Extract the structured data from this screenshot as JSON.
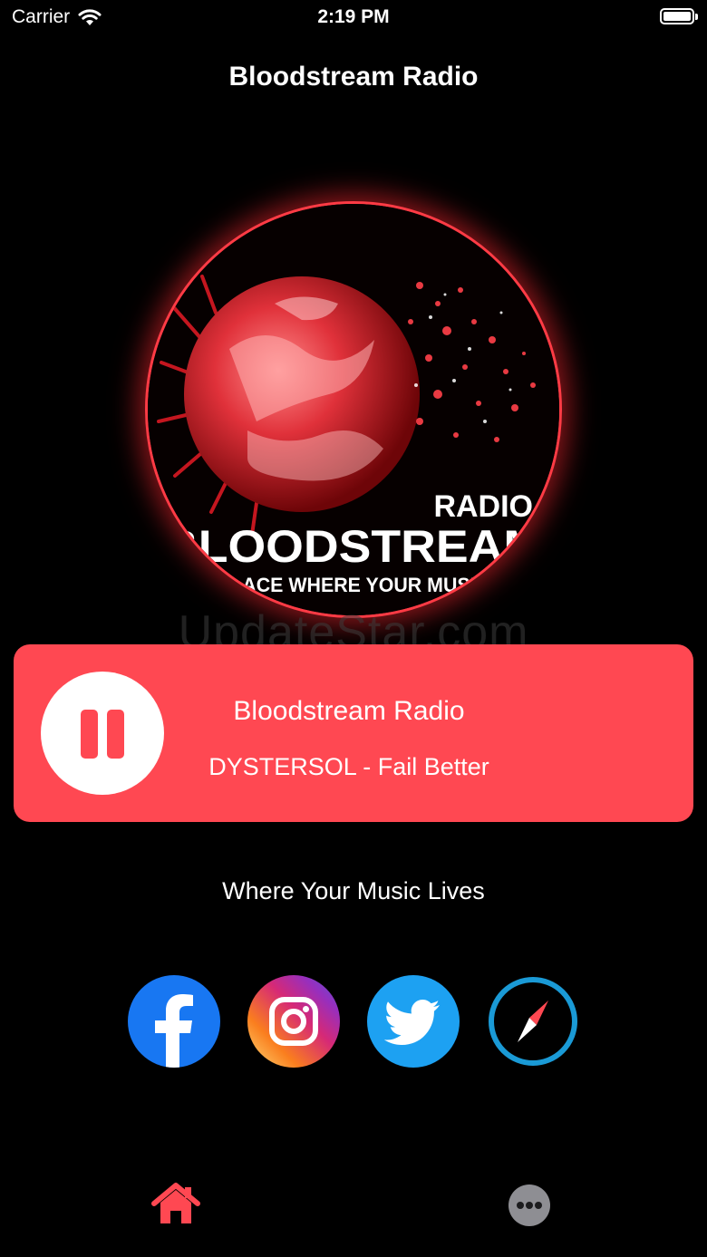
{
  "status_bar": {
    "carrier": "Carrier",
    "time": "2:19 PM",
    "battery_level": 1.0
  },
  "nav": {
    "title": "Bloodstream Radio"
  },
  "logo": {
    "small_text": "RADIO",
    "main_text": "BLOODSTREAM",
    "slogan_text": "PLACE WHERE YOUR MUSIC",
    "accent_color": "#ff3b45"
  },
  "watermark": "UpdateStar.com",
  "player": {
    "state": "playing",
    "control_icon": "pause-icon",
    "station": "Bloodstream Radio",
    "track": "DYSTERSOL - Fail Better",
    "card_color": "#ff4852"
  },
  "tagline": "Where Your Music Lives",
  "social": [
    {
      "name": "facebook",
      "icon": "facebook-icon",
      "color": "#1877f2"
    },
    {
      "name": "instagram",
      "icon": "instagram-icon",
      "color": "#d62976"
    },
    {
      "name": "twitter",
      "icon": "twitter-icon",
      "color": "#1da1f2"
    },
    {
      "name": "website",
      "icon": "compass-icon",
      "color": "#1a9ad6"
    }
  ],
  "tab_bar": {
    "items": [
      {
        "icon": "home-icon",
        "selected": true,
        "color": "#ff4852"
      },
      {
        "icon": "more-icon",
        "selected": false,
        "color": "#8e8e93"
      }
    ]
  }
}
